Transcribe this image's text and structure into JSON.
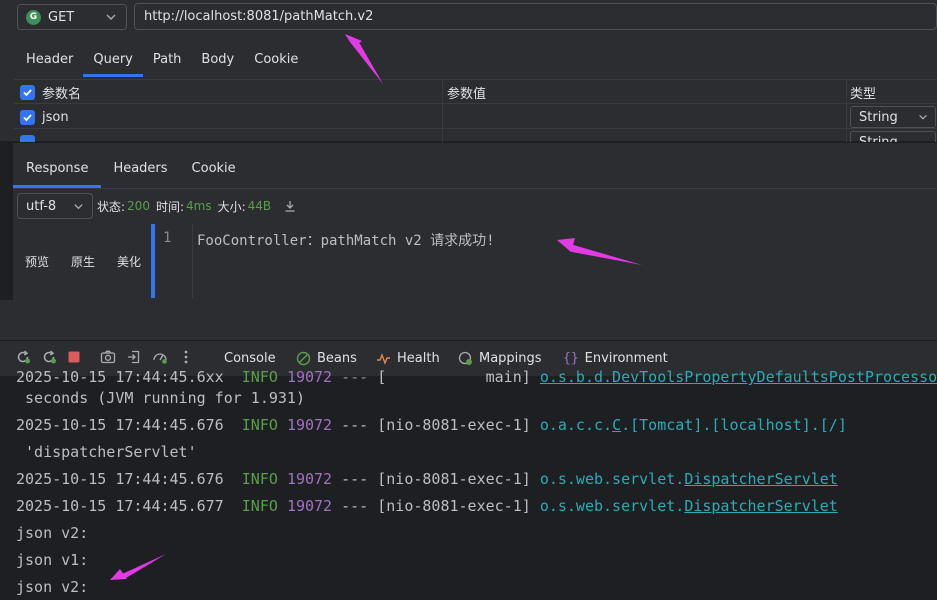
{
  "request": {
    "method": "GET",
    "method_badge": "G",
    "url": "http://localhost:8081/pathMatch.v2",
    "tabs": [
      "Header",
      "Query",
      "Path",
      "Body",
      "Cookie"
    ],
    "active_tab": "Query",
    "params": {
      "headers": [
        "参数名",
        "参数值",
        "类型"
      ],
      "rows": [
        {
          "name": "json",
          "value": "",
          "type": "String",
          "checked": true
        },
        {
          "name": "",
          "value": "",
          "type": "String",
          "checked": true
        }
      ]
    }
  },
  "response": {
    "tabs": [
      "Response",
      "Headers",
      "Cookie"
    ],
    "active_tab": "Response",
    "encoding": "utf-8",
    "status_label": "状态:",
    "status_value": "200",
    "time_label": "时间:",
    "time_value": "4ms",
    "size_label": "大小:",
    "size_value": "44B",
    "view_modes": [
      "预览",
      "原生",
      "美化"
    ],
    "line_number": "1",
    "body": "FooController：pathMatch v2 请求成功!"
  },
  "run_window": {
    "tabs": [
      {
        "label": "Console",
        "icon": "none"
      },
      {
        "label": "Beans",
        "icon": "beans-icon"
      },
      {
        "label": "Health",
        "icon": "health-icon"
      },
      {
        "label": "Mappings",
        "icon": "mappings-icon"
      },
      {
        "label": "Environment",
        "icon": "environment-icon"
      }
    ],
    "toolbar_icons": [
      "rerun-icon",
      "rerun-failed-icon",
      "stop-icon",
      "screenshot-icon",
      "exit-icon",
      "gauge-icon",
      "more-icon"
    ]
  },
  "console": {
    "lines": [
      {
        "ts": "2025-10-15 17:44:45.6xx",
        "level": "INFO",
        "pid": "19072",
        "sep": "---",
        "thread": "[           main]",
        "logger": "o.s.b.d.DevToolsPropertyDefaultsPostProcessor",
        "clipped": true
      },
      {
        "text": " seconds (JVM running for 1.931)"
      },
      {
        "ts": "2025-10-15 17:44:45.676",
        "level": "INFO",
        "pid": "19072",
        "sep": "---",
        "thread": "[nio-8081-exec-1]",
        "logger_prefix": "o.a.c.c.",
        "logger_ul": "C",
        "logger_rest": ".[Tomcat].[localhost].[/]"
      },
      {
        "text": " 'dispatcherServlet'"
      },
      {
        "ts": "2025-10-15 17:44:45.676",
        "level": "INFO",
        "pid": "19072",
        "sep": "---",
        "thread": "[nio-8081-exec-1]",
        "logger_prefix": "o.s.web.servlet.",
        "logger_ul": "DispatcherServlet"
      },
      {
        "ts": "2025-10-15 17:44:45.677",
        "level": "INFO",
        "pid": "19072",
        "sep": "---",
        "thread": "[nio-8081-exec-1]",
        "logger_prefix": "o.s.web.servlet.",
        "logger_ul": "DispatcherServlet"
      },
      {
        "text": "json v2:"
      },
      {
        "text": "json v1:"
      },
      {
        "text": "json v2:"
      }
    ]
  },
  "colors": {
    "accent": "#3574f0",
    "arrow": "#e23be6",
    "info": "#5a9e4b",
    "pid": "#a171c2",
    "logger": "#2aacb8"
  }
}
